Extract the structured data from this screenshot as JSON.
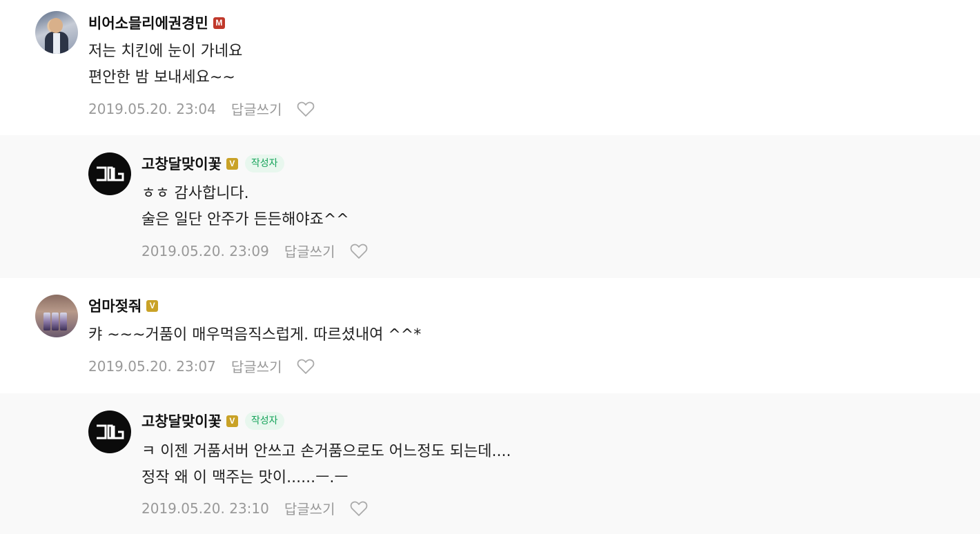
{
  "comments": [
    {
      "author": "비어소믈리에권경민",
      "badge": "M",
      "lines": [
        "저는 치킨에 눈이 가네요",
        "편안한 밤 보내세요~~"
      ],
      "timestamp": "2019.05.20. 23:04",
      "reply_label": "답글쓰기"
    },
    {
      "author": "고창달맞이꽃",
      "badge": "V",
      "author_tag": "작성자",
      "lines": [
        "ㅎㅎ 감사합니다.",
        "술은 일단 안주가 든든해야죠^^"
      ],
      "timestamp": "2019.05.20. 23:09",
      "reply_label": "답글쓰기"
    },
    {
      "author": "엄마젖줘",
      "badge": "V",
      "lines": [
        "캬 ~~~거품이 매우먹음직스럽게. 따르셨내여 ^^*"
      ],
      "timestamp": "2019.05.20. 23:07",
      "reply_label": "답글쓰기"
    },
    {
      "author": "고창달맞이꽃",
      "badge": "V",
      "author_tag": "작성자",
      "lines": [
        "ㅋ 이젠 거품서버 안쓰고 손거품으로도 어느정도 되는데....",
        "정작 왜 이 맥주는 맛이......ㅡ.ㅡ"
      ],
      "timestamp": "2019.05.20. 23:10",
      "reply_label": "답글쓰기"
    }
  ],
  "colors": {
    "reply_background": "#f9f9f9",
    "author_tag_bg": "#e8f7ee",
    "author_tag_text": "#16a35a",
    "badge_m": "#c0392b",
    "badge_v": "#c9a227",
    "meta_text": "#999999"
  },
  "icons": {
    "like": "heart-outline-icon",
    "author_logo": "gd-logo-icon"
  }
}
